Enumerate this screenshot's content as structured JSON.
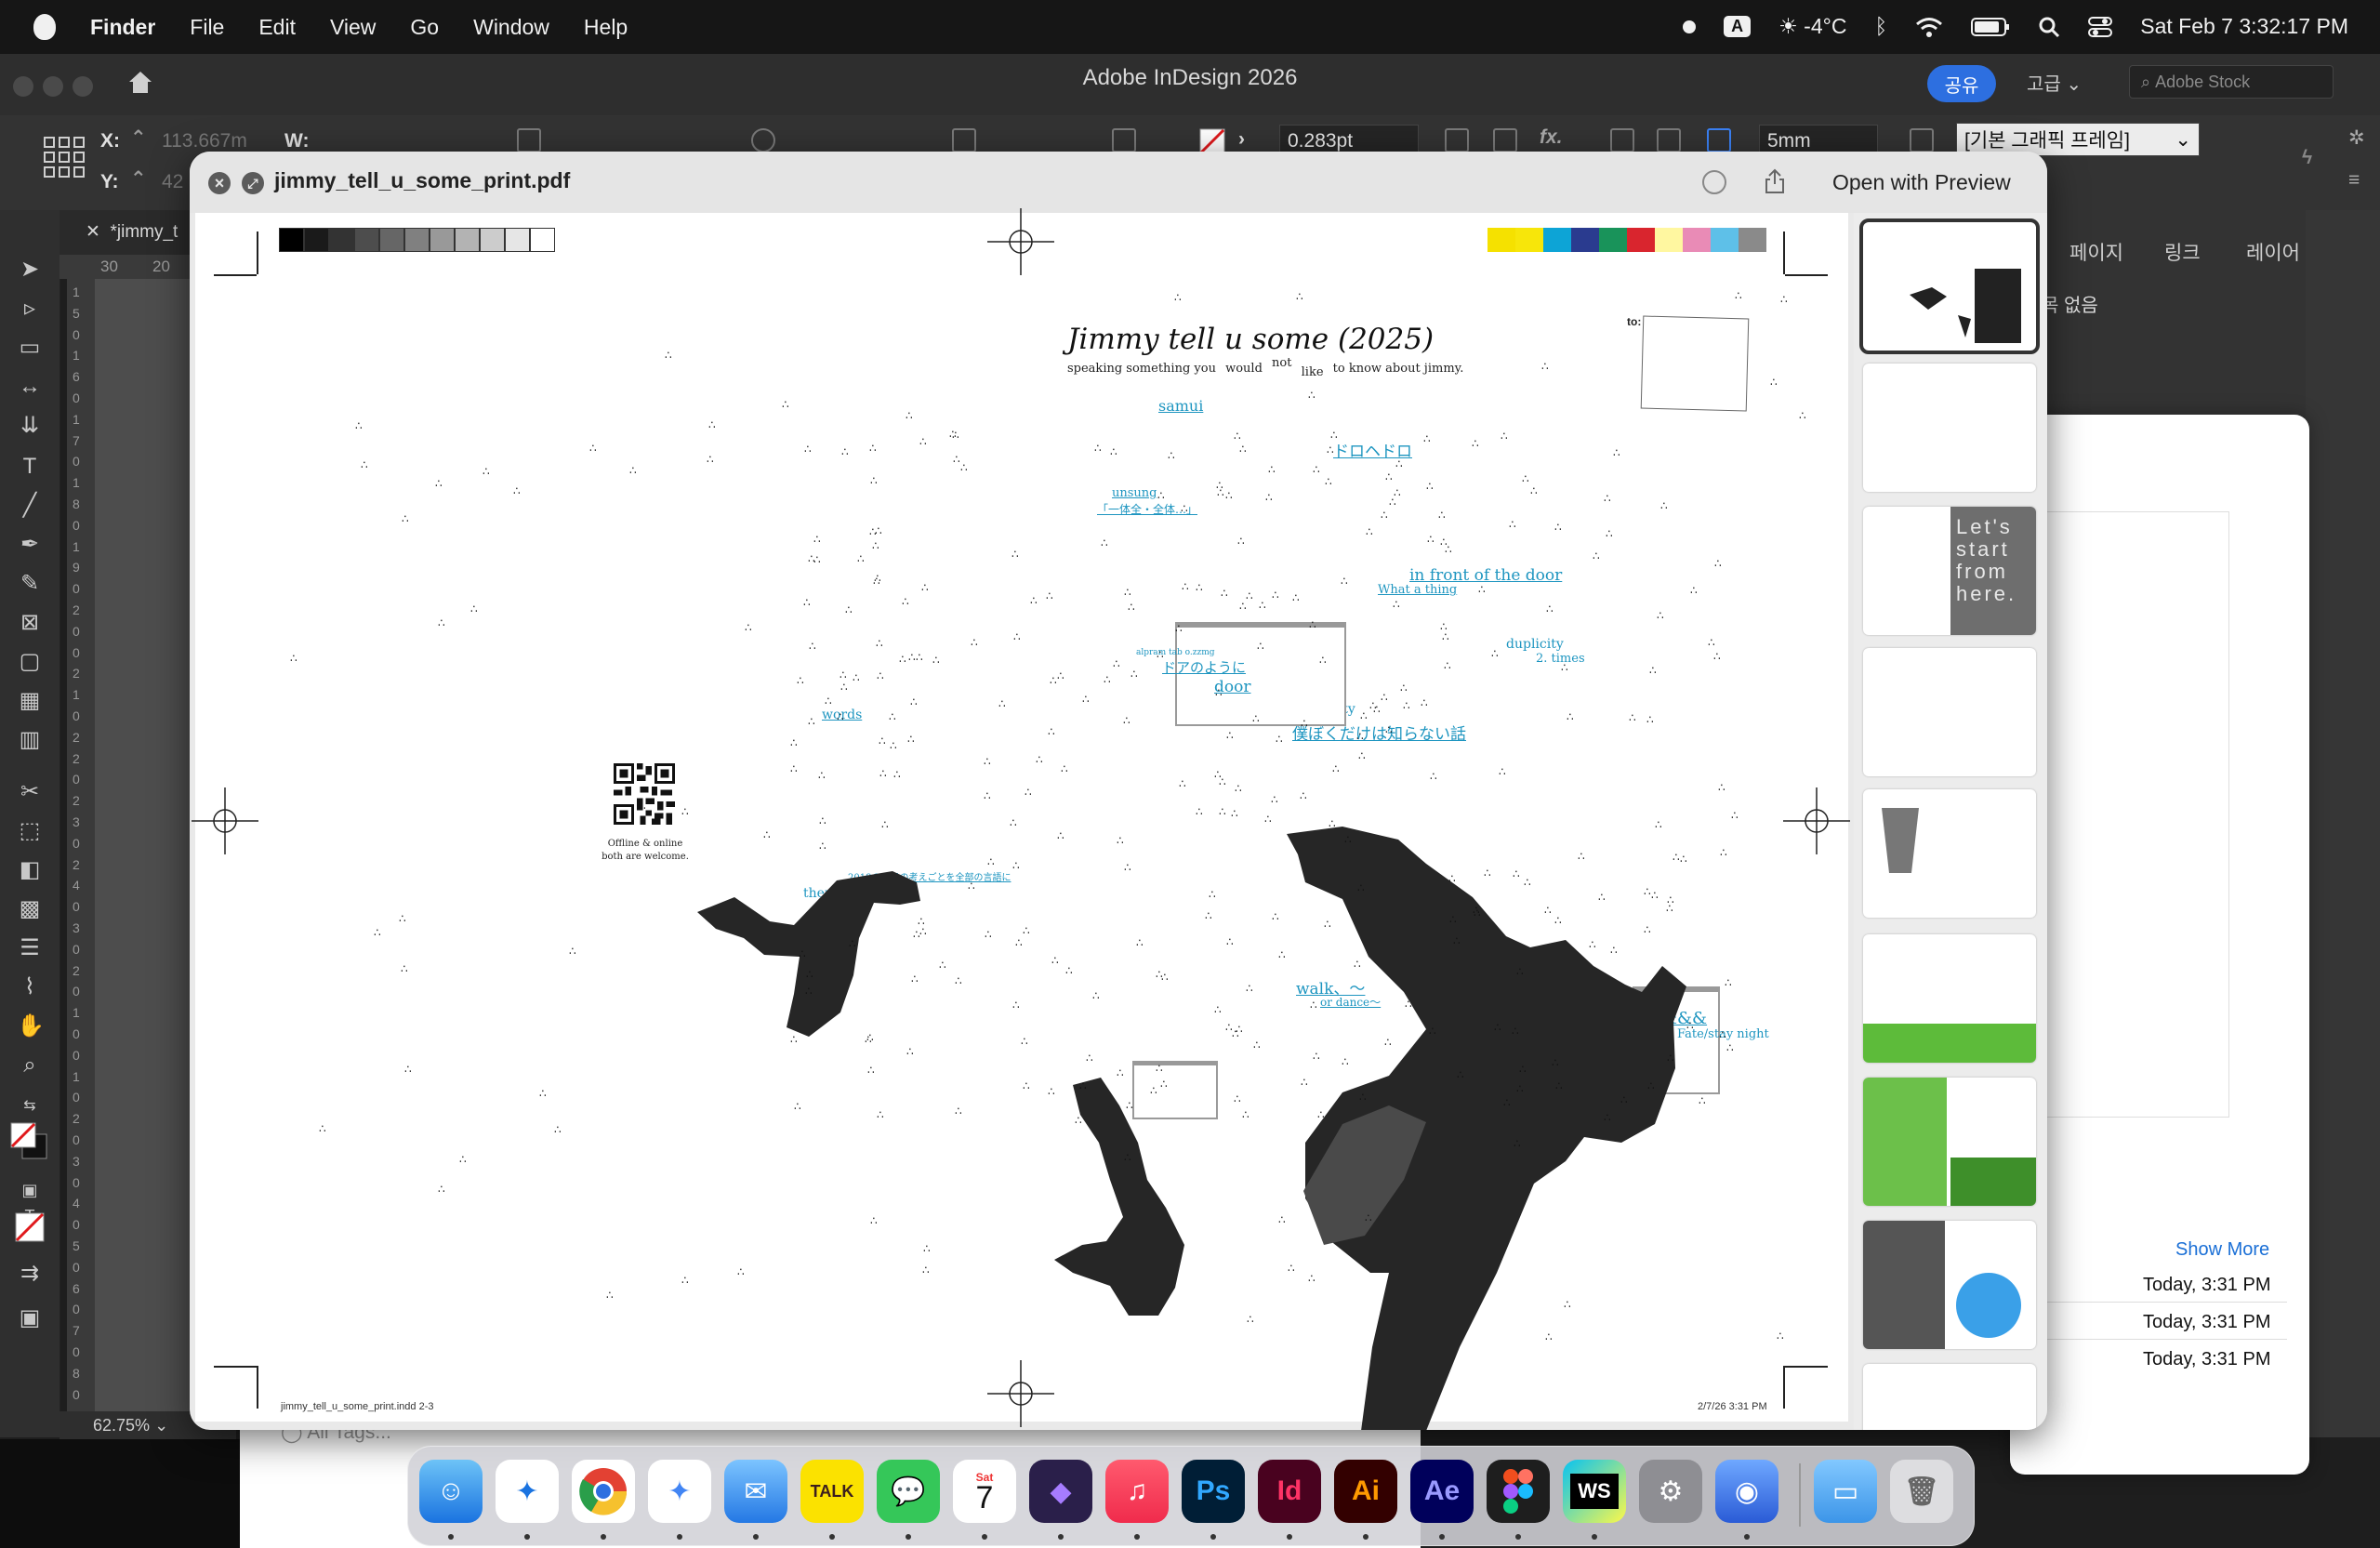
{
  "menubar": {
    "app": "Finder",
    "menus": [
      "File",
      "Edit",
      "View",
      "Go",
      "Window",
      "Help"
    ],
    "input_badge": "A",
    "weather": "-4°C",
    "datetime": "Sat Feb 7  3:32:17 PM"
  },
  "indesign": {
    "title": "Adobe InDesign 2026",
    "share": "공유",
    "advanced": "고급",
    "stock_placeholder": "Adobe Stock",
    "x_label": "X:",
    "x_value": "113.667m",
    "y_label": "Y:",
    "y_value": "42",
    "w_label": "W:",
    "stroke_weight": "0.283pt",
    "gap": "5mm",
    "frame_style": "[기본 그래픽 프레임]",
    "doc_tab": "*jimmy_t",
    "ruler_h": [
      "30",
      "20"
    ],
    "ruler_v": [
      "1",
      "5",
      "0",
      "1",
      "6",
      "0",
      "1",
      "7",
      "0",
      "1",
      "8",
      "0",
      "1",
      "9",
      "0",
      "2",
      "0",
      "0",
      "2",
      "1",
      "0",
      "2",
      "2",
      "0",
      "2",
      "3",
      "0",
      "2",
      "4",
      "0",
      "3",
      "0",
      "2",
      "0",
      "1",
      "0",
      "0",
      "1",
      "0",
      "2",
      "0",
      "3",
      "0",
      "4",
      "0",
      "5",
      "0",
      "6",
      "0",
      "7",
      "0",
      "8",
      "0"
    ],
    "zoom": "62.75%",
    "panel_tabs": [
      "페이지",
      "링크",
      "레이어"
    ],
    "panel_none": "목 없음",
    "all_tags": "All Tags...",
    "show_more": "Show More",
    "recent_times": [
      "Today, 3:31 PM",
      "Today, 3:31 PM",
      "Today, 3:31 PM"
    ]
  },
  "quicklook": {
    "filename": "jimmy_tell_u_some_print.pdf",
    "open_with": "Open with Preview"
  },
  "pdf": {
    "title": "Jimmy tell u some (2025)",
    "subtitle_a": "speaking something you",
    "subtitle_b": "would",
    "subtitle_c": "not",
    "subtitle_d": "like",
    "subtitle_e": "to know about jimmy.",
    "to_label": "to:",
    "qr_caption_1": "Offline & online",
    "qr_caption_2": "both are welcome.",
    "footer_left": "jimmy_tell_u_some_print.indd   2-3",
    "footer_right": "2/7/26   3:31 PM",
    "words": {
      "samui": "samui",
      "dorohedoro": "ドロヘドロ",
      "unsung": "unsung",
      "unsung_jp": "「一体全・全体…」",
      "in_front": "in front of the door",
      "what_thing": "What a thing",
      "duplicity_1": "duplicity",
      "two_times": "2. times",
      "door": "door",
      "door_jp": "ドアのように",
      "door_small": "alpram tab o.zzmg",
      "words": "words",
      "duplicity_2": "duplicity",
      "jp_mid": "僕ぼくだけは知らない話",
      "therefore": "therefore",
      "jp_small": "2018の一日の考えごとを全部の言語に",
      "walk": "walk、〜",
      "or_dance": "or dance〜",
      "amp": "&&&",
      "fate": "Fate/stay night"
    },
    "thumb_text": "Let's start from here."
  },
  "colors": {
    "accent": "#2d6fe0",
    "cyan_text": "#1d95c0",
    "reg_swatches": [
      "#f5e100",
      "#f7e60a",
      "#0da4d6",
      "#2a3b8f",
      "#19935a",
      "#d9252e",
      "#fff7a0",
      "#e98bb6",
      "#5ec0e8",
      "#8a8a8a"
    ],
    "gray_swatches": [
      "#000000",
      "#1a1a1a",
      "#333333",
      "#4d4d4d",
      "#666666",
      "#808080",
      "#999999",
      "#b3b3b3",
      "#cccccc",
      "#e6e6e6",
      "#ffffff"
    ]
  },
  "dock": {
    "apps": [
      "Finder",
      "Safari",
      "Chrome",
      "Gemini",
      "Mail",
      "KakaoTalk",
      "Messages",
      "Calendar",
      "Obsidian",
      "Music",
      "Photoshop",
      "InDesign",
      "Illustrator",
      "After Effects",
      "Figma",
      "WebStorm",
      "System Settings",
      "Raycast",
      "Folder",
      "Trash"
    ],
    "calendar_day": "Sat",
    "calendar_date": "7",
    "talk": "TALK",
    "ps": "Ps",
    "id": "Id",
    "ai": "Ai",
    "ae": "Ae",
    "ws": "WS"
  }
}
